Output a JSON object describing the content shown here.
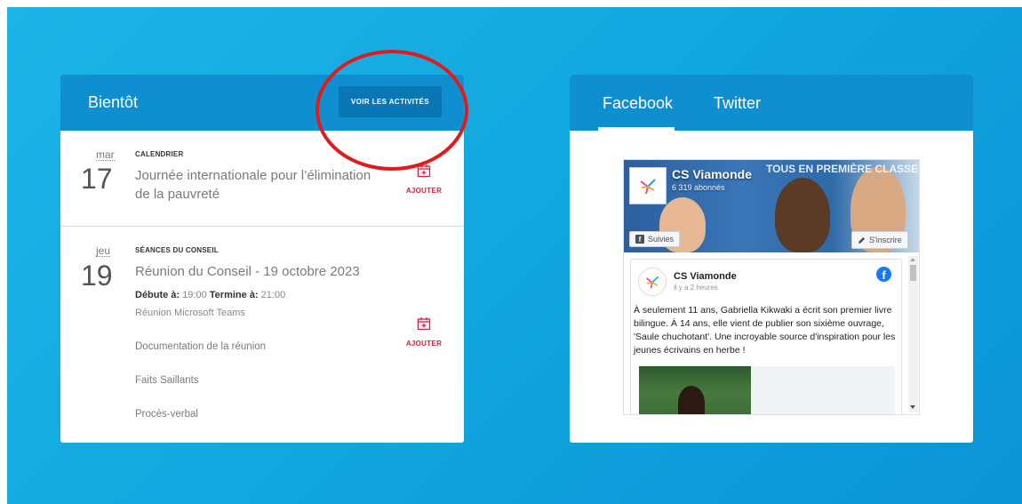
{
  "events_card": {
    "title": "Bientôt",
    "view_all_label": "VOIR LES ACTIVITÉS",
    "events": [
      {
        "day_of_week": "mar",
        "day": "17",
        "category": "CALENDRIER",
        "title": "Journée internationale pour l’élimination de la pauvreté",
        "add_label": "AJOUTER"
      },
      {
        "day_of_week": "jeu",
        "day": "19",
        "category": "SÉANCES DU CONSEIL",
        "title": "Réunion du Conseil - 19 octobre 2023",
        "start_label": "Débute à:",
        "start_time": "19:00",
        "end_label": "Termine à:",
        "end_time": "21:00",
        "location": "Réunion Microsoft Teams",
        "links": [
          "Documentation de la réunion",
          "Faits Saillants",
          "Procès-verbal"
        ],
        "add_label": "AJOUTER"
      }
    ]
  },
  "social_card": {
    "tabs": [
      "Facebook",
      "Twitter"
    ],
    "active_tab": "Facebook",
    "facebook": {
      "page_name": "CS Viamonde",
      "followers": "6 319 abonnés",
      "cover_slogan": "TOUS EN PREMIÈRE CLASSE",
      "followed_label": "Suivies",
      "subscribe_label": "S'inscrire",
      "post": {
        "author": "CS Viamonde",
        "time": "il y a 2 heures",
        "text": "À seulement 11 ans, Gabriella Kikwaki a écrit son premier livre bilingue. À 14 ans, elle vient de publier son sixième ouvrage, 'Saule chuchotant'. Une incroyable source d'inspiration pour les jeunes écrivains en herbe !"
      }
    }
  },
  "colors": {
    "background": "#12a8df",
    "card_header": "#0f8fd0",
    "button": "#0877b4",
    "add_accent": "#d0233a",
    "annotation_circle": "#e01b1b"
  },
  "icons": [
    "calendar-add-icon",
    "facebook-icon",
    "pencil-icon",
    "viamonde-logo-icon"
  ]
}
